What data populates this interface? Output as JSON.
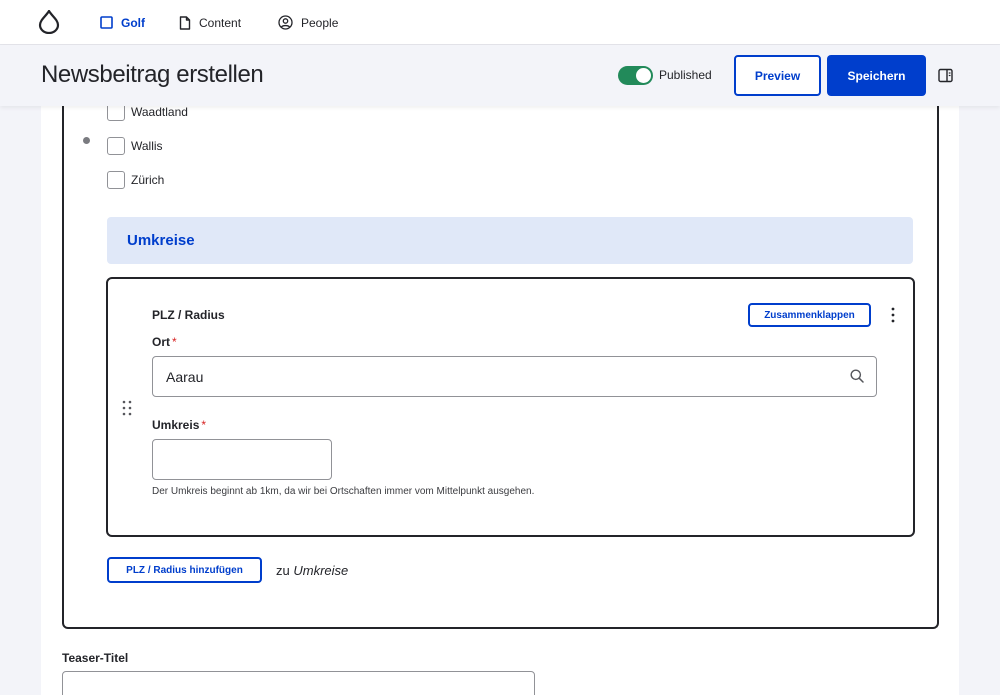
{
  "toolbar": {
    "logo_name": "drupal-drop-icon",
    "items": [
      {
        "label": "Golf",
        "icon": "square-icon",
        "active": true
      },
      {
        "label": "Content",
        "icon": "document-icon",
        "active": false
      },
      {
        "label": "People",
        "icon": "user-circle-icon",
        "active": false
      }
    ]
  },
  "header": {
    "title": "Newsbeitrag erstellen",
    "published_label": "Published",
    "published": true,
    "preview_label": "Preview",
    "save_label": "Speichern"
  },
  "regions": {
    "checkboxes": [
      {
        "label": "Waadtland",
        "checked": false
      },
      {
        "label": "Wallis",
        "checked": false
      },
      {
        "label": "Zürich",
        "checked": false
      }
    ]
  },
  "umkreise": {
    "section_title": "Umkreise",
    "item": {
      "title": "PLZ / Radius",
      "collapse_label": "Zusammenklappen",
      "ort_label": "Ort",
      "ort_required": "*",
      "ort_value": "Aarau",
      "umkreis_label": "Umkreis",
      "umkreis_required": "*",
      "umkreis_value": "",
      "help_text": "Der Umkreis beginnt ab 1km, da wir bei Ortschaften immer vom Mittelpunkt ausgehen."
    },
    "add_button_label": "PLZ / Radius hinzufügen",
    "add_suffix_prefix": "zu",
    "add_suffix_target": "Umkreise"
  },
  "teaser": {
    "label": "Teaser-Titel",
    "value": ""
  },
  "colors": {
    "accent": "#003ecc",
    "toggle_on": "#228a5a",
    "required": "#d72222",
    "section_bg": "#e0e8f8"
  }
}
